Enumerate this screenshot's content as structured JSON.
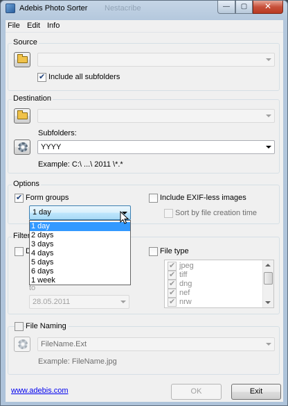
{
  "window": {
    "title": "Adebis Photo Sorter",
    "background_window_title": "Nestacribe",
    "minimize_label": "—",
    "maximize_label": "▢",
    "close_label": "✕"
  },
  "menu": [
    "File",
    "Edit",
    "Info"
  ],
  "source": {
    "title": "Source",
    "path_value": "",
    "include_subfolders_label": "Include all subfolders",
    "include_subfolders_checked": true
  },
  "destination": {
    "title": "Destination",
    "path_value": "",
    "subfolders_label": "Subfolders:",
    "subfolders_value": "YYYY",
    "example": "Example: C:\\ ...\\ 2011 \\*.*"
  },
  "options": {
    "title": "Options",
    "form_groups_label": "Form groups",
    "form_groups_checked": true,
    "group_interval_value": "1 day",
    "group_interval_options": [
      "1 day",
      "2 days",
      "3 days",
      "4 days",
      "5 days",
      "6 days",
      "1 week"
    ],
    "include_exifless_label": "Include EXIF-less images",
    "sort_by_creation_label": "Sort by file creation time"
  },
  "filters": {
    "title": "Filters",
    "date_label_fragment": "D",
    "to_label": "to",
    "to_date_value": "28.05.2011",
    "file_type_label": "File type",
    "file_types": [
      "jpeg",
      "tiff",
      "dng",
      "nef",
      "nrw"
    ]
  },
  "file_naming": {
    "title": "File Naming",
    "pattern_value": "FileName.Ext",
    "example": "Example: FileName.jpg"
  },
  "footer": {
    "link": "www.adebis.com",
    "ok_label": "OK",
    "exit_label": "Exit"
  }
}
